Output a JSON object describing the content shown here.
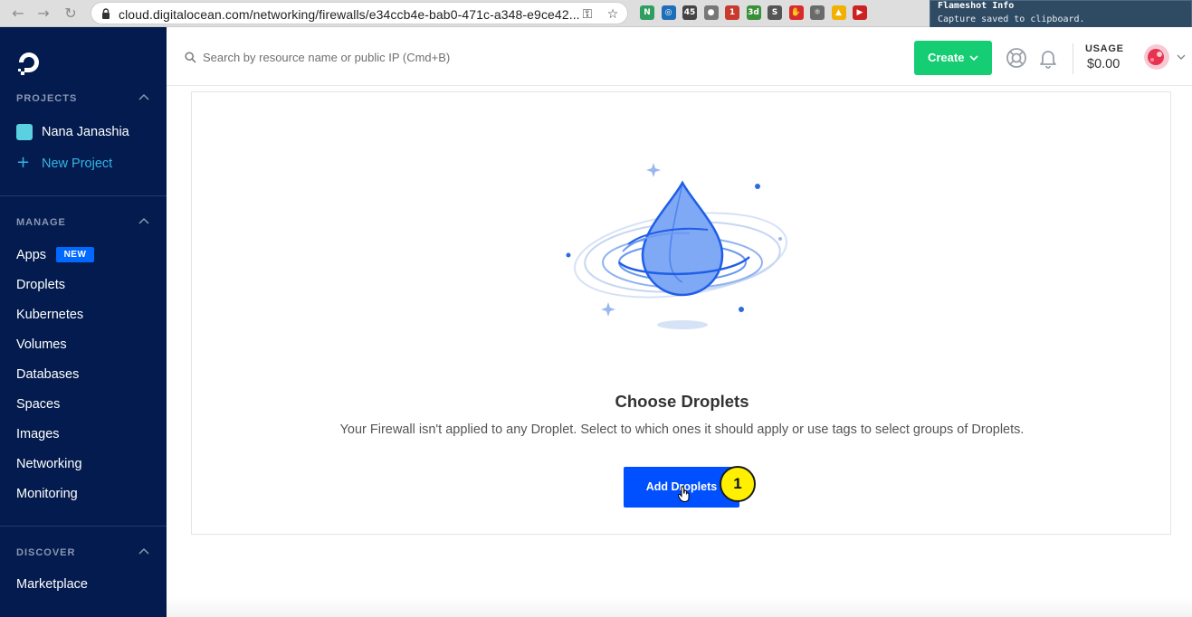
{
  "browser": {
    "url": "cloud.digitalocean.com/networking/firewalls/e34ccb4e-bab0-471c-a348-e9ce42...",
    "back_icon": "arrow-left-icon",
    "forward_icon": "arrow-right-icon",
    "reload_icon": "reload-icon",
    "extensions": [
      {
        "name": "notion-ext",
        "color": "#2f9e60",
        "label": "N"
      },
      {
        "name": "blue-circle-ext",
        "color": "#1e6fb8",
        "label": "◎"
      },
      {
        "name": "counter-ext",
        "color": "#444444",
        "label": "45"
      },
      {
        "name": "apple-ext",
        "color": "#777777",
        "label": "●"
      },
      {
        "name": "mail-ext",
        "color": "#c83a2e",
        "label": "1"
      },
      {
        "name": "calendar-ext",
        "color": "#3a8f3a",
        "label": "3d"
      },
      {
        "name": "s-ext",
        "color": "#555555",
        "label": "S"
      },
      {
        "name": "stop-ext",
        "color": "#d92b2b",
        "label": "✋"
      },
      {
        "name": "react-ext",
        "color": "#6a6a6a",
        "label": "⚛"
      },
      {
        "name": "drive-ext",
        "color": "#f2b100",
        "label": "▲"
      },
      {
        "name": "red-ext",
        "color": "#c22",
        "label": "▶"
      }
    ]
  },
  "notification": {
    "title": "Flameshot Info",
    "message": "Capture saved to clipboard."
  },
  "sidebar": {
    "projects_title": "PROJECTS",
    "project_name": "Nana Janashia",
    "new_project": "New Project",
    "manage_title": "MANAGE",
    "items": [
      {
        "label": "Apps",
        "badge": "NEW"
      },
      {
        "label": "Droplets"
      },
      {
        "label": "Kubernetes"
      },
      {
        "label": "Volumes"
      },
      {
        "label": "Databases"
      },
      {
        "label": "Spaces"
      },
      {
        "label": "Images"
      },
      {
        "label": "Networking"
      },
      {
        "label": "Monitoring"
      }
    ],
    "discover_title": "DISCOVER",
    "discover_items": [
      {
        "label": "Marketplace"
      }
    ]
  },
  "header": {
    "search_placeholder": "Search by resource name or public IP (Cmd+B)",
    "create_label": "Create",
    "usage_label": "USAGE",
    "usage_value": "$0.00"
  },
  "main": {
    "title": "Choose Droplets",
    "description": "Your Firewall isn't applied to any Droplet. Select to which ones it should apply or use tags to select groups of Droplets.",
    "add_button": "Add Droplets",
    "step_badge": "1"
  },
  "colors": {
    "sidebar_bg": "#031b4e",
    "accent_blue": "#0069ff",
    "create_green": "#15cd72",
    "badge_yellow": "#ffef00"
  }
}
